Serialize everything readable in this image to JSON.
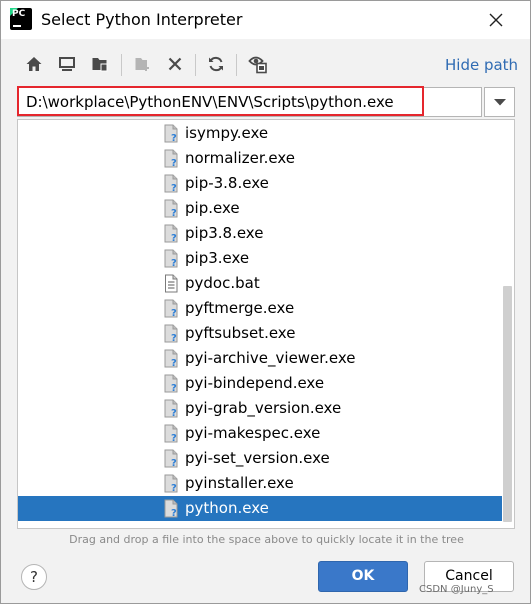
{
  "window": {
    "title": "Select Python Interpreter",
    "app_icon": "pycharm-logo",
    "close_icon": "close-icon"
  },
  "toolbar": {
    "buttons": [
      {
        "name": "home",
        "icon": "home-icon"
      },
      {
        "name": "desktop",
        "icon": "desktop-icon"
      },
      {
        "name": "project",
        "icon": "project-folder-icon"
      },
      {
        "name": "new-folder",
        "icon": "new-folder-icon"
      },
      {
        "name": "delete",
        "icon": "delete-icon"
      },
      {
        "name": "refresh",
        "icon": "refresh-icon"
      },
      {
        "name": "show-hidden",
        "icon": "show-hidden-icon"
      }
    ],
    "hide_path_label": "Hide path"
  },
  "path_field": {
    "value": "D:\\workplace\\PythonENV\\ENV\\Scripts\\python.exe",
    "highlight_color": "#e5262d"
  },
  "tree": {
    "items": [
      {
        "name": "isympy.exe",
        "icon": "unknown-file-icon",
        "selected": false
      },
      {
        "name": "normalizer.exe",
        "icon": "unknown-file-icon",
        "selected": false
      },
      {
        "name": "pip-3.8.exe",
        "icon": "unknown-file-icon",
        "selected": false
      },
      {
        "name": "pip.exe",
        "icon": "unknown-file-icon",
        "selected": false
      },
      {
        "name": "pip3.8.exe",
        "icon": "unknown-file-icon",
        "selected": false
      },
      {
        "name": "pip3.exe",
        "icon": "unknown-file-icon",
        "selected": false
      },
      {
        "name": "pydoc.bat",
        "icon": "text-file-icon",
        "selected": false
      },
      {
        "name": "pyftmerge.exe",
        "icon": "unknown-file-icon",
        "selected": false
      },
      {
        "name": "pyftsubset.exe",
        "icon": "unknown-file-icon",
        "selected": false
      },
      {
        "name": "pyi-archive_viewer.exe",
        "icon": "unknown-file-icon",
        "selected": false
      },
      {
        "name": "pyi-bindepend.exe",
        "icon": "unknown-file-icon",
        "selected": false
      },
      {
        "name": "pyi-grab_version.exe",
        "icon": "unknown-file-icon",
        "selected": false
      },
      {
        "name": "pyi-makespec.exe",
        "icon": "unknown-file-icon",
        "selected": false
      },
      {
        "name": "pyi-set_version.exe",
        "icon": "unknown-file-icon",
        "selected": false
      },
      {
        "name": "pyinstaller.exe",
        "icon": "unknown-file-icon",
        "selected": false
      },
      {
        "name": "python.exe",
        "icon": "unknown-file-icon",
        "selected": true
      }
    ],
    "selected_color": "#2675bf"
  },
  "hint": "Drag and drop a file into the space above to quickly locate it in the tree",
  "buttons": {
    "help": "?",
    "ok": "OK",
    "cancel": "Cancel"
  },
  "watermark": "CSDN @Juny_S",
  "colors": {
    "accent": "#3a78c9",
    "link": "#2f6bb3"
  }
}
